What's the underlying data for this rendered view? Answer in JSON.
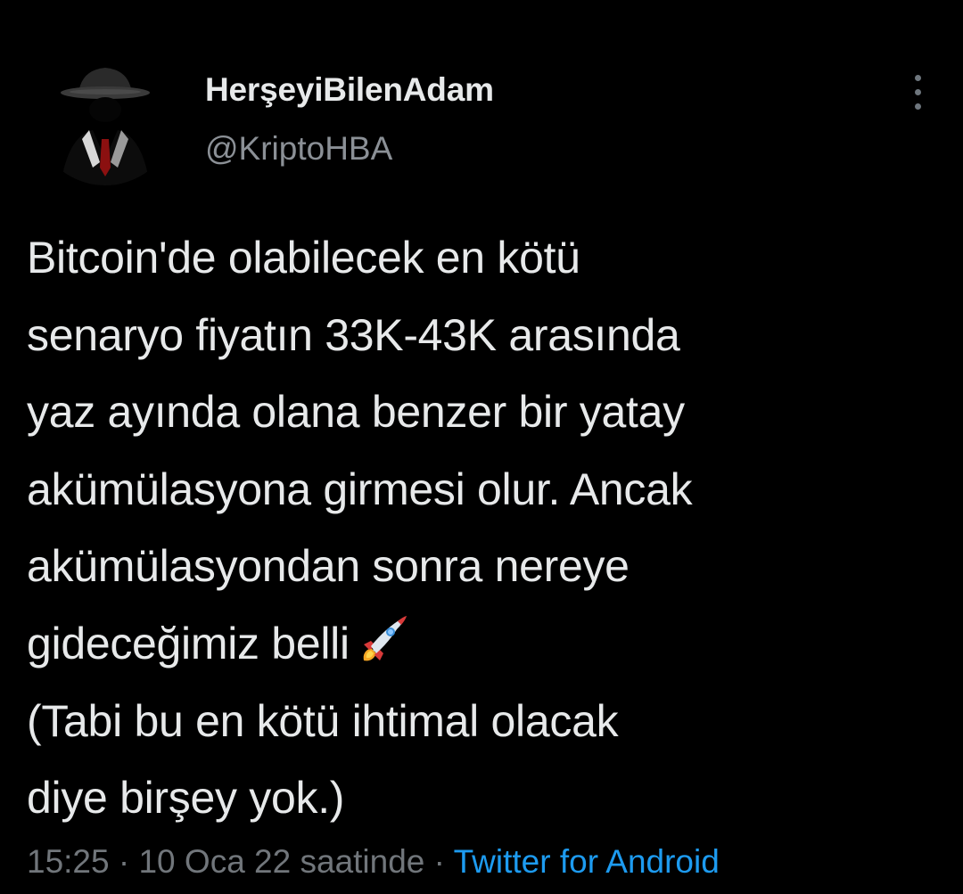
{
  "user": {
    "display_name": "HerşeyiBilenAdam",
    "handle": "@KriptoHBA"
  },
  "tweet": {
    "lines": [
      "Bitcoin'de olabilecek en kötü",
      "senaryo fiyatın 33K-43K arasında",
      "yaz ayında olana benzer bir yatay",
      "akümülasyona girmesi olur. Ancak",
      "akümülasyondan sonra nereye",
      "gideceğimiz belli",
      "(Tabi bu en kötü ihtimal olacak",
      "diye birşey yok.)"
    ],
    "emoji_icon": "rocket-emoji-icon"
  },
  "meta": {
    "time": "15:25",
    "separator": "·",
    "date": "10 Oca 22 saatinde",
    "source": "Twitter for Android"
  },
  "icons": {
    "more": "more-vertical-icon",
    "avatar": "masked-man-avatar"
  },
  "colors": {
    "background": "#000000",
    "text": "#e7e9ea",
    "secondary": "#71767b",
    "link": "#1d9bf0"
  }
}
